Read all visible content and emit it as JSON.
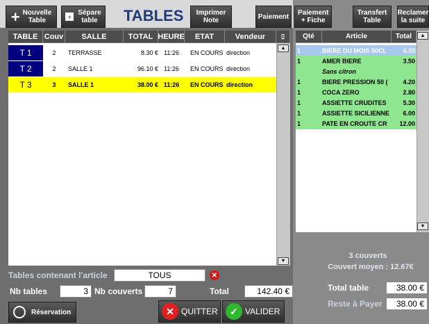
{
  "toolbar": {
    "new_table": "Nouvelle\nTable",
    "split_table": "Sépare\ntable",
    "title": "TABLES",
    "print_note": "Imprimer\nNote",
    "payment": "Paiement",
    "payment_fiche": "Paiement\n+ Fiche",
    "transfer_table": "Transfert\nTable",
    "resume": "Reclamer\nla suite"
  },
  "tables": {
    "headers": [
      "TABLE",
      "Couv",
      "SALLE",
      "TOTAL",
      "HEURE",
      "ETAT",
      "Vendeur"
    ],
    "rows": [
      {
        "table": "T 1",
        "couv": "2",
        "salle": "TERRASSE",
        "total": "8.30 €",
        "heure": "11:26",
        "etat": "EN COURS",
        "vendeur": "direction"
      },
      {
        "table": "T 2",
        "couv": "2",
        "salle": "SALLE 1",
        "total": "96.10 €",
        "heure": "11:26",
        "etat": "EN COURS",
        "vendeur": "direction"
      },
      {
        "table": "T 3",
        "couv": "3",
        "salle": "SALLE 1",
        "total": "38.00 €",
        "heure": "11:26",
        "etat": "EN COURS",
        "vendeur": "direction"
      }
    ]
  },
  "order": {
    "headers": [
      "Qté",
      "Article",
      "Total"
    ],
    "rows": [
      {
        "qty": "1",
        "article": "BIERE DU MOIS 50CL",
        "total": "4.20"
      },
      {
        "qty": "1",
        "article": "AMER BIERE",
        "total": "3.50"
      },
      {
        "qty": "",
        "article": "Sans citron",
        "total": ""
      },
      {
        "qty": "1",
        "article": "BIERE PRESSION 50 (",
        "total": "4.20"
      },
      {
        "qty": "1",
        "article": "COCA ZERO",
        "total": "2.80"
      },
      {
        "qty": "1",
        "article": "ASSIETTE CRUDITES",
        "total": "5.30"
      },
      {
        "qty": "1",
        "article": "ASSIETTE SICILIENNE",
        "total": "6.00"
      },
      {
        "qty": "1",
        "article": "PATE EN CROUTE CR",
        "total": "12.00"
      }
    ],
    "covers_text": "3 couverts",
    "avg_cover_text": "Couvert moyen : 12.67€",
    "total_table_label": "Total table",
    "total_table_value": "38.00 €",
    "remaining_label": "Reste à Payer",
    "remaining_value": "38.00 €"
  },
  "filter": {
    "label": "Tables contenant l'article",
    "value": "TOUS"
  },
  "summary": {
    "nb_tables_label": "Nb tables",
    "nb_tables_value": "3",
    "nb_couverts_label": "Nb couverts",
    "nb_couverts_value": "7",
    "total_label": "Total",
    "total_value": "142.40 €"
  },
  "actions": {
    "reservation": "Réservation",
    "quit": "QUITTER",
    "validate": "VALIDER"
  },
  "colors": {
    "selected_row": "#ffff00",
    "table_cell": "#000080",
    "order_selected": "#a9c8f0",
    "order_bg": "#8ee68e"
  }
}
